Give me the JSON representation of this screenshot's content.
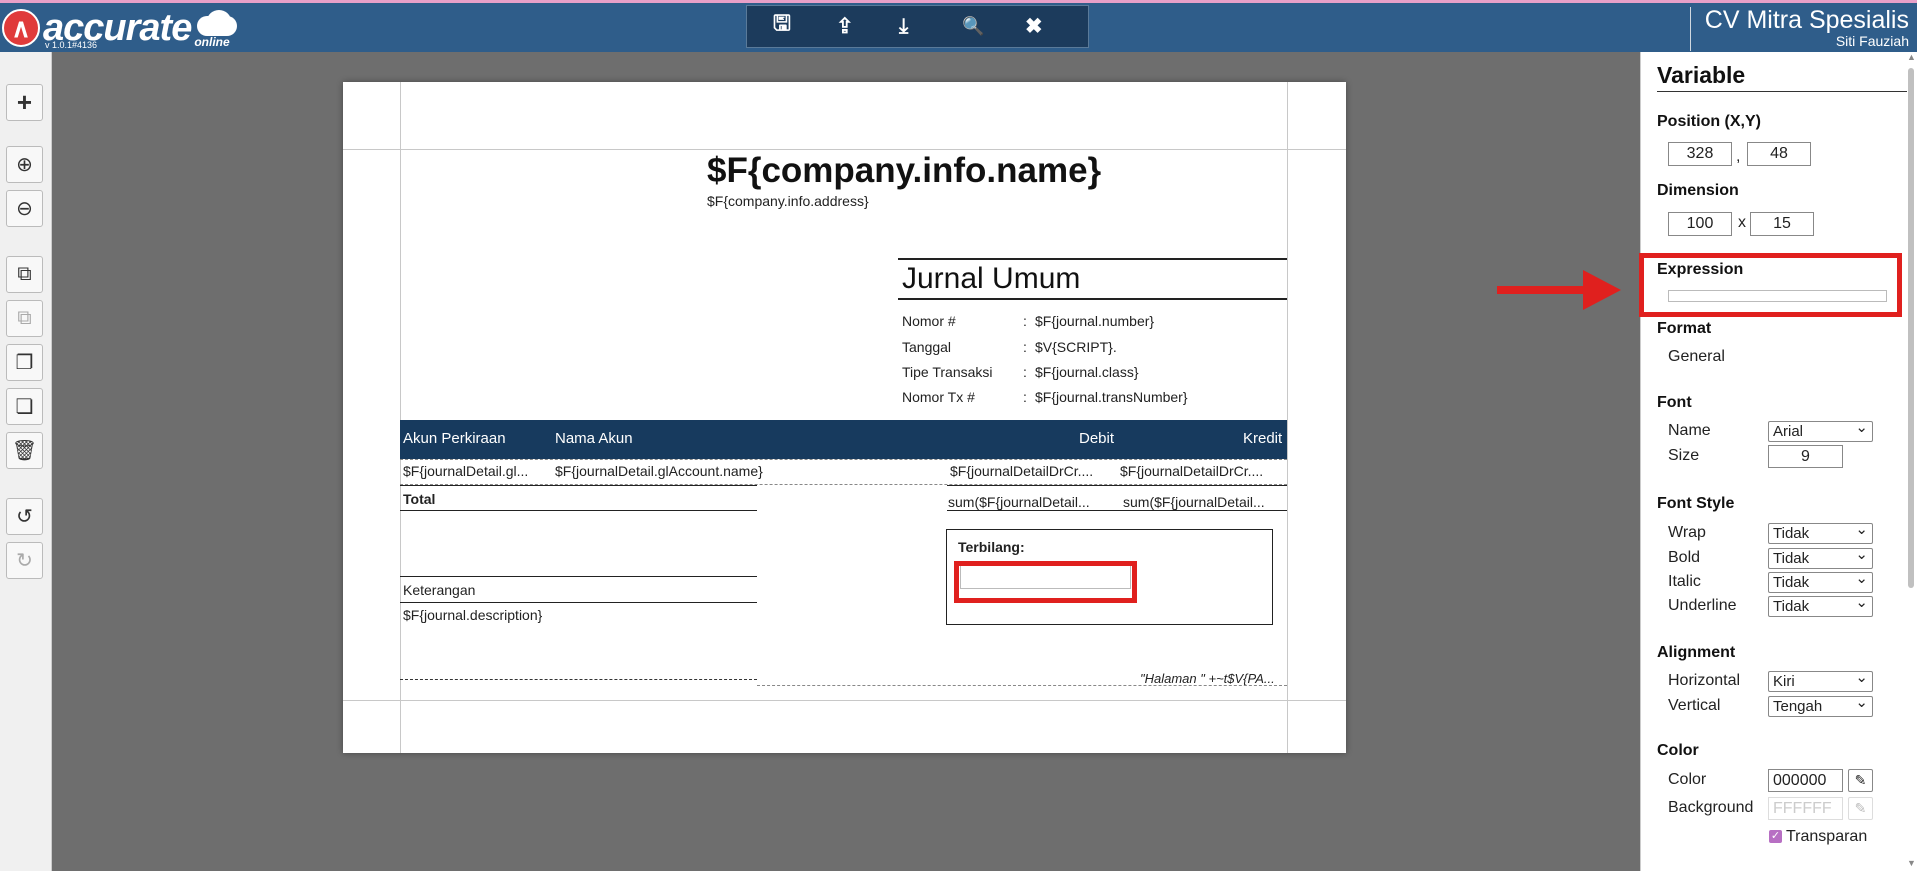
{
  "header": {
    "logo_word": "accurate",
    "logo_sub": "online",
    "version": "v 1.0.1#4136",
    "company": "CV Mitra Spesialis",
    "user": "Siti Fauziah",
    "bar_color": "#2f5d8a",
    "toolbar": [
      {
        "name": "save-icon",
        "glyph": "🖫"
      },
      {
        "name": "export-icon",
        "glyph": "⇪"
      },
      {
        "name": "import-icon",
        "glyph": "⤓"
      },
      {
        "name": "preview-icon",
        "glyph": "🔍"
      },
      {
        "name": "close-icon",
        "glyph": "✖"
      }
    ]
  },
  "left_toolbar": [
    "add-icon",
    "zoom-in-icon",
    "zoom-out-icon",
    "copy-icon",
    "paste-icon",
    "bring-front-icon",
    "send-back-icon",
    "delete-icon",
    "undo-icon",
    "redo-icon"
  ],
  "report": {
    "company_name": "$F{company.info.name}",
    "company_address": "$F{company.info.address}",
    "title": "Jurnal Umum",
    "info_rows": [
      {
        "label": "Nomor #",
        "sep": ":",
        "value": "$F{journal.number}"
      },
      {
        "label": "Tanggal",
        "sep": ":",
        "value": "$V{SCRIPT}."
      },
      {
        "label": "Tipe Transaksi",
        "sep": ":",
        "value": "$F{journal.class}"
      },
      {
        "label": "Nomor Tx #",
        "sep": ":",
        "value": "$F{journal.transNumber}"
      }
    ],
    "table_header": {
      "akun": "Akun Perkiraan",
      "nama": "Nama Akun",
      "debit": "Debit",
      "kredit": "Kredit"
    },
    "detail": {
      "akun": "$F{journalDetail.gl...",
      "nama": "$F{journalDetail.glAccount.name}",
      "debit": "$F{journalDetailDrCr....",
      "kredit": "$F{journalDetailDrCr...."
    },
    "total_label": "Total",
    "total_debit": "sum($F{journalDetail...",
    "total_kredit": "sum($F{journalDetail...",
    "terbilang": "Terbilang:",
    "keterangan": "Keterangan",
    "description": "$F{journal.description}",
    "page_footer": "\"Halaman \" +~t$V{PA..."
  },
  "panel": {
    "title": "Variable",
    "position_label": "Position (X,Y)",
    "pos_x": "328",
    "pos_sep": ",",
    "pos_y": "48",
    "dimension_label": "Dimension",
    "dim_w": "100",
    "dim_sep": "x",
    "dim_h": "15",
    "expression_label": "Expression",
    "expression_value": "",
    "format_label": "Format",
    "format_value": "General",
    "font_label": "Font",
    "font_name_label": "Name",
    "font_name_value": "Arial",
    "font_size_label": "Size",
    "font_size_value": "9",
    "font_style_label": "Font Style",
    "wrap_label": "Wrap",
    "wrap_value": "Tidak",
    "bold_label": "Bold",
    "bold_value": "Tidak",
    "italic_label": "Italic",
    "italic_value": "Tidak",
    "underline_label": "Underline",
    "underline_value": "Tidak",
    "alignment_label": "Alignment",
    "horizontal_label": "Horizontal",
    "horizontal_value": "Kiri",
    "vertical_label": "Vertical",
    "vertical_value": "Tengah",
    "color_section_label": "Color",
    "color_label": "Color",
    "color_value": "000000",
    "background_label": "Background",
    "background_value": "FFFFFF",
    "transparan_label": "Transparan",
    "transparan_checked": true
  },
  "annotations": {
    "highlight_color": "#e0201e"
  }
}
